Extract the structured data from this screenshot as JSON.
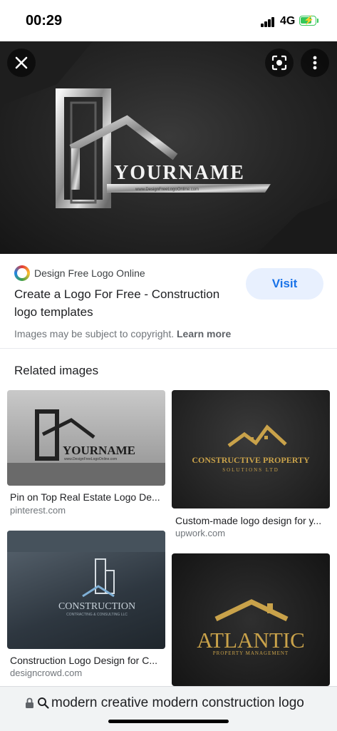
{
  "status_bar": {
    "time": "00:29",
    "network": "4G"
  },
  "hero": {
    "logo_text": "YOURNAME",
    "logo_url_text": "www.DesignFreeLogoOnline.com"
  },
  "result": {
    "source": "Design Free Logo Online",
    "title": "Create a Logo For Free - Construction logo templates",
    "visit_label": "Visit",
    "copyright_text": "Images may be subject to copyright.",
    "learn_more": "Learn more"
  },
  "related": {
    "heading": "Related images",
    "items": [
      {
        "title": "Pin on Top Real Estate Logo De...",
        "domain": "pinterest.com",
        "image_text": "YOURNAME",
        "image_subtext": "www.DesignFreeLogoOnline.com"
      },
      {
        "title": "Custom-made logo design for y...",
        "domain": "upwork.com",
        "image_text": "CONSTRUCTIVE PROPERTY",
        "image_subtext": "SOLUTIONS LTD"
      },
      {
        "title": "Construction Logo Design for C...",
        "domain": "designcrowd.com",
        "image_text": "CONSTRUCTION",
        "image_subtext": "CONTRACTING & CONSULTING LLC"
      },
      {
        "title": "",
        "domain": "",
        "image_text": "ATLANTIC",
        "image_subtext": "PROPERTY MANAGEMENT"
      }
    ]
  },
  "bottom_bar": {
    "query": "modern creative modern construction logo"
  },
  "colors": {
    "accent": "#1a73e8",
    "visit_bg": "#e8f0fe",
    "gold": "#c9a24a",
    "battery": "#34c759"
  },
  "icons": [
    "close-icon",
    "lens-icon",
    "more-vert-icon",
    "lock-icon",
    "search-icon"
  ]
}
